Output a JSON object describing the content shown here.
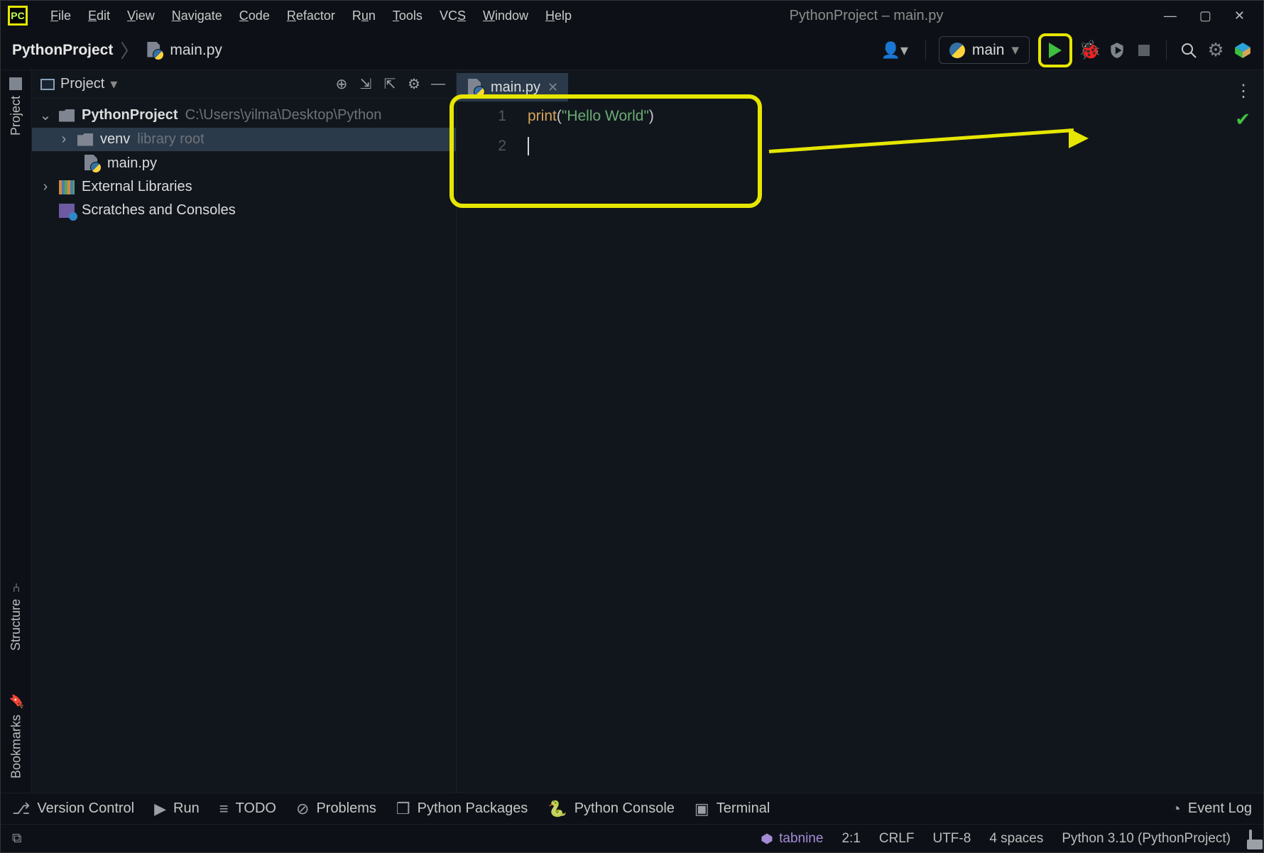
{
  "app_icon_text": "PC",
  "menu": {
    "file": "File",
    "edit": "Edit",
    "view": "View",
    "navigate": "Navigate",
    "code": "Code",
    "refactor": "Refactor",
    "run": "Run",
    "tools": "Tools",
    "vcs": "VCS",
    "window": "Window",
    "help": "Help"
  },
  "window_title": "PythonProject – main.py",
  "breadcrumb": {
    "project": "PythonProject",
    "file": "main.py"
  },
  "run_config": {
    "name": "main"
  },
  "left_rail": {
    "project": "Project",
    "structure": "Structure",
    "bookmarks": "Bookmarks"
  },
  "project_panel": {
    "title": "Project",
    "root": {
      "name": "PythonProject",
      "path": "C:\\Users\\yilma\\Desktop\\Python"
    },
    "venv": {
      "name": "venv",
      "tag": "library root"
    },
    "file": "main.py",
    "external": "External Libraries",
    "scratches": "Scratches and Consoles"
  },
  "editor": {
    "tab": "main.py",
    "lines": [
      "1",
      "2"
    ],
    "code": {
      "fn": "print",
      "open": "(",
      "str": "\"Hello World\"",
      "close": ")"
    }
  },
  "tools": {
    "version_control": "Version Control",
    "run": "Run",
    "todo": "TODO",
    "problems": "Problems",
    "py_packages": "Python Packages",
    "py_console": "Python Console",
    "terminal": "Terminal",
    "event_log": "Event Log"
  },
  "status": {
    "tabnine": "tabnine",
    "pos": "2:1",
    "line_sep": "CRLF",
    "encoding": "UTF-8",
    "indent": "4 spaces",
    "interpreter": "Python 3.10 (PythonProject)"
  }
}
